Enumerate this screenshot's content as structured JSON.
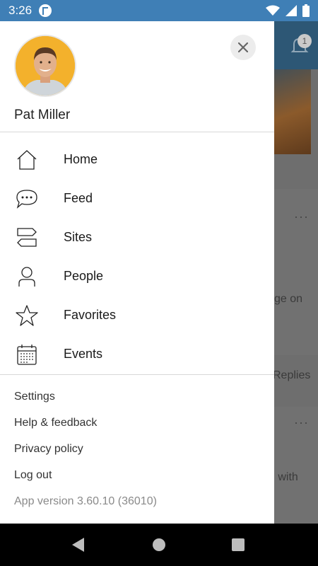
{
  "status_bar": {
    "time": "3:26",
    "icons": [
      "app-notification-icon",
      "wifi-icon",
      "cell-signal-icon",
      "battery-icon"
    ]
  },
  "background": {
    "notification_count": "1",
    "snippets": [
      "ge on",
      "Replies",
      "g with"
    ]
  },
  "drawer": {
    "user": {
      "name": "Pat Miller",
      "avatar": "avatar"
    },
    "nav": [
      {
        "label": "Home",
        "icon": "home-icon"
      },
      {
        "label": "Feed",
        "icon": "chat-bubble-icon"
      },
      {
        "label": "Sites",
        "icon": "signpost-icon"
      },
      {
        "label": "People",
        "icon": "person-icon"
      },
      {
        "label": "Favorites",
        "icon": "star-icon"
      },
      {
        "label": "Events",
        "icon": "calendar-icon"
      }
    ],
    "links": [
      {
        "label": "Settings"
      },
      {
        "label": "Help & feedback"
      },
      {
        "label": "Privacy policy"
      },
      {
        "label": "Log out"
      }
    ],
    "version": "App version 3.60.10 (36010)"
  },
  "colors": {
    "status_bar": "#3f7fb6",
    "avatar_bg": "#f3b12c",
    "drawer_bg": "#ffffff"
  }
}
